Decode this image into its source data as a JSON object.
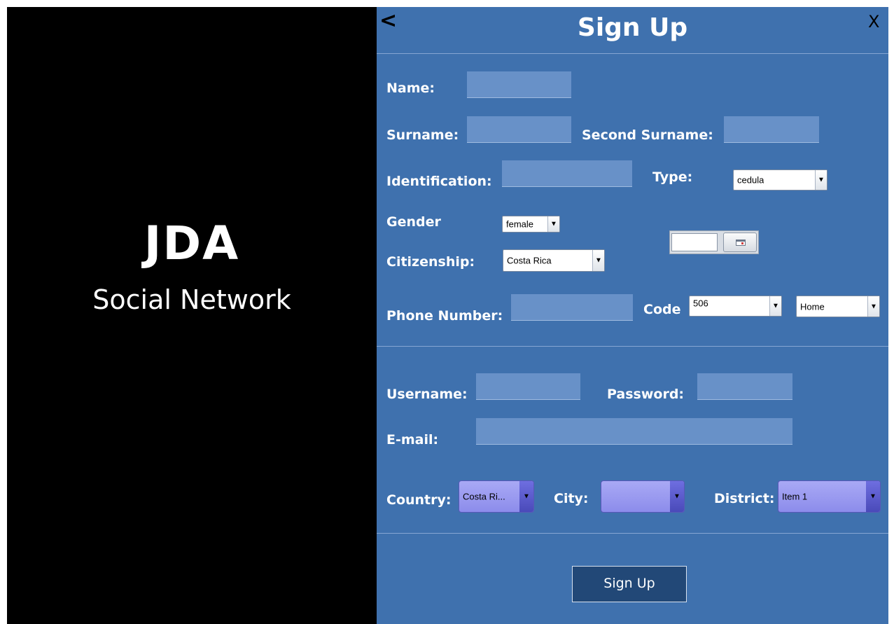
{
  "brand": {
    "title": "JDA",
    "subtitle": "Social Network"
  },
  "header": {
    "back_label": "<",
    "title": "Sign Up",
    "close_label": "X"
  },
  "personal": {
    "name_label": "Name:",
    "surname_label": "Surname:",
    "second_surname_label": "Second Surname:",
    "identification_label": "Identification:",
    "type_label": "Type:",
    "type_value": "cedula",
    "gender_label": "Gender",
    "gender_value": "female",
    "citizenship_label": "Citizenship:",
    "citizenship_value": "Costa Rica",
    "date_value": "",
    "phone_label": "Phone Number:",
    "code_label": "Code",
    "code_value": "506",
    "phone_type_value": "Home"
  },
  "account": {
    "username_label": "Username:",
    "password_label": "Password:",
    "email_label": "E-mail:"
  },
  "location": {
    "country_label": "Country:",
    "country_value": "Costa Ri...",
    "city_label": "City:",
    "city_value": "",
    "district_label": "District:",
    "district_value": "Item 1"
  },
  "submit": {
    "label": "Sign Up"
  },
  "icons": {
    "dropdown_arrow": "▼",
    "calendar": "calendar-icon"
  },
  "colors": {
    "panel": "#3f71ae",
    "field": "#6891c8",
    "purple_combo": "#9696ee"
  }
}
